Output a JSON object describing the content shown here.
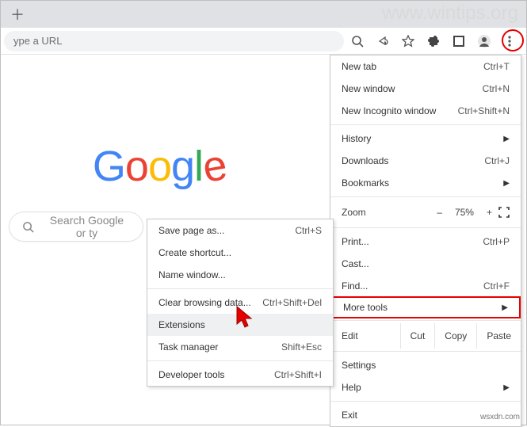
{
  "watermark": "www.wintips.org",
  "footer": "wsxdn.com",
  "omnibox_placeholder": "ype a URL",
  "search_placeholder": "Search Google or ty",
  "main_menu": {
    "new_tab": "New tab",
    "new_tab_sc": "Ctrl+T",
    "new_window": "New window",
    "new_window_sc": "Ctrl+N",
    "incognito": "New Incognito window",
    "incognito_sc": "Ctrl+Shift+N",
    "history": "History",
    "downloads": "Downloads",
    "downloads_sc": "Ctrl+J",
    "bookmarks": "Bookmarks",
    "zoom": "Zoom",
    "minus": "–",
    "pct": "75%",
    "plus": "+",
    "print": "Print...",
    "print_sc": "Ctrl+P",
    "cast": "Cast...",
    "find": "Find...",
    "find_sc": "Ctrl+F",
    "more_tools": "More tools",
    "edit": "Edit",
    "cut": "Cut",
    "copy": "Copy",
    "paste": "Paste",
    "settings": "Settings",
    "help": "Help",
    "exit": "Exit"
  },
  "submenu": {
    "save_page": "Save page as...",
    "save_page_sc": "Ctrl+S",
    "create_shortcut": "Create shortcut...",
    "name_window": "Name window...",
    "clear_data": "Clear browsing data...",
    "clear_data_sc": "Ctrl+Shift+Del",
    "extensions": "Extensions",
    "task_manager": "Task manager",
    "task_manager_sc": "Shift+Esc",
    "dev_tools": "Developer tools",
    "dev_tools_sc": "Ctrl+Shift+I"
  }
}
